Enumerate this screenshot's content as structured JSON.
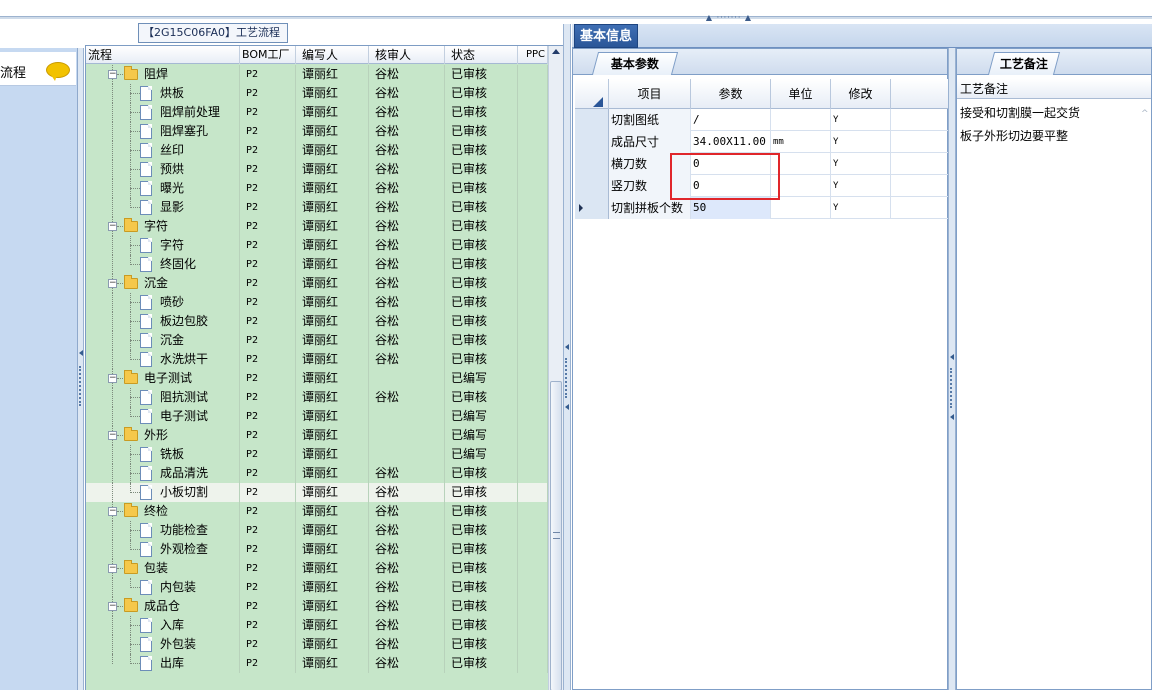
{
  "process_panel": {
    "title": "【2G15C06FA0】工艺流程",
    "headers": {
      "name": "流程",
      "bom": "BOM工厂",
      "writer": "编写人",
      "checker": "核审人",
      "status": "状态",
      "ppc": "PPC"
    }
  },
  "left_panel": {
    "item_label": "流程"
  },
  "tree_rows": [
    {
      "level": 0,
      "type": "folder",
      "name": "阻焊",
      "bom": "P2",
      "writer": "谭丽红",
      "checker": "谷松",
      "status": "已审核"
    },
    {
      "level": 1,
      "type": "doc",
      "name": "烘板",
      "bom": "P2",
      "writer": "谭丽红",
      "checker": "谷松",
      "status": "已审核"
    },
    {
      "level": 1,
      "type": "doc",
      "name": "阻焊前处理",
      "bom": "P2",
      "writer": "谭丽红",
      "checker": "谷松",
      "status": "已审核"
    },
    {
      "level": 1,
      "type": "doc",
      "name": "阻焊塞孔",
      "bom": "P2",
      "writer": "谭丽红",
      "checker": "谷松",
      "status": "已审核"
    },
    {
      "level": 1,
      "type": "doc",
      "name": "丝印",
      "bom": "P2",
      "writer": "谭丽红",
      "checker": "谷松",
      "status": "已审核"
    },
    {
      "level": 1,
      "type": "doc",
      "name": "预烘",
      "bom": "P2",
      "writer": "谭丽红",
      "checker": "谷松",
      "status": "已审核"
    },
    {
      "level": 1,
      "type": "doc",
      "name": "曝光",
      "bom": "P2",
      "writer": "谭丽红",
      "checker": "谷松",
      "status": "已审核"
    },
    {
      "level": 1,
      "type": "doc",
      "name": "显影",
      "bom": "P2",
      "writer": "谭丽红",
      "checker": "谷松",
      "status": "已审核",
      "last": true
    },
    {
      "level": 0,
      "type": "folder",
      "name": "字符",
      "bom": "P2",
      "writer": "谭丽红",
      "checker": "谷松",
      "status": "已审核"
    },
    {
      "level": 1,
      "type": "doc",
      "name": "字符",
      "bom": "P2",
      "writer": "谭丽红",
      "checker": "谷松",
      "status": "已审核"
    },
    {
      "level": 1,
      "type": "doc",
      "name": "终固化",
      "bom": "P2",
      "writer": "谭丽红",
      "checker": "谷松",
      "status": "已审核",
      "last": true
    },
    {
      "level": 0,
      "type": "folder",
      "name": "沉金",
      "bom": "P2",
      "writer": "谭丽红",
      "checker": "谷松",
      "status": "已审核"
    },
    {
      "level": 1,
      "type": "doc",
      "name": "喷砂",
      "bom": "P2",
      "writer": "谭丽红",
      "checker": "谷松",
      "status": "已审核"
    },
    {
      "level": 1,
      "type": "doc",
      "name": "板边包胶",
      "bom": "P2",
      "writer": "谭丽红",
      "checker": "谷松",
      "status": "已审核"
    },
    {
      "level": 1,
      "type": "doc",
      "name": "沉金",
      "bom": "P2",
      "writer": "谭丽红",
      "checker": "谷松",
      "status": "已审核"
    },
    {
      "level": 1,
      "type": "doc",
      "name": "水洗烘干",
      "bom": "P2",
      "writer": "谭丽红",
      "checker": "谷松",
      "status": "已审核",
      "last": true
    },
    {
      "level": 0,
      "type": "folder",
      "name": "电子测试",
      "bom": "P2",
      "writer": "谭丽红",
      "checker": "",
      "status": "已编写"
    },
    {
      "level": 1,
      "type": "doc",
      "name": "阻抗测试",
      "bom": "P2",
      "writer": "谭丽红",
      "checker": "谷松",
      "status": "已审核"
    },
    {
      "level": 1,
      "type": "doc",
      "name": "电子测试",
      "bom": "P2",
      "writer": "谭丽红",
      "checker": "",
      "status": "已编写",
      "last": true
    },
    {
      "level": 0,
      "type": "folder",
      "name": "外形",
      "bom": "P2",
      "writer": "谭丽红",
      "checker": "",
      "status": "已编写"
    },
    {
      "level": 1,
      "type": "doc",
      "name": "铣板",
      "bom": "P2",
      "writer": "谭丽红",
      "checker": "",
      "status": "已编写"
    },
    {
      "level": 1,
      "type": "doc",
      "name": "成品清洗",
      "bom": "P2",
      "writer": "谭丽红",
      "checker": "谷松",
      "status": "已审核"
    },
    {
      "level": 1,
      "type": "doc",
      "name": "小板切割",
      "bom": "P2",
      "writer": "谭丽红",
      "checker": "谷松",
      "status": "已审核",
      "last": true,
      "selected": true
    },
    {
      "level": 0,
      "type": "folder",
      "name": "终检",
      "bom": "P2",
      "writer": "谭丽红",
      "checker": "谷松",
      "status": "已审核"
    },
    {
      "level": 1,
      "type": "doc",
      "name": "功能检查",
      "bom": "P2",
      "writer": "谭丽红",
      "checker": "谷松",
      "status": "已审核"
    },
    {
      "level": 1,
      "type": "doc",
      "name": "外观检查",
      "bom": "P2",
      "writer": "谭丽红",
      "checker": "谷松",
      "status": "已审核",
      "last": true
    },
    {
      "level": 0,
      "type": "folder",
      "name": "包装",
      "bom": "P2",
      "writer": "谭丽红",
      "checker": "谷松",
      "status": "已审核"
    },
    {
      "level": 1,
      "type": "doc",
      "name": "内包装",
      "bom": "P2",
      "writer": "谭丽红",
      "checker": "谷松",
      "status": "已审核",
      "last": true
    },
    {
      "level": 0,
      "type": "folder",
      "name": "成品仓",
      "bom": "P2",
      "writer": "谭丽红",
      "checker": "谷松",
      "status": "已审核"
    },
    {
      "level": 1,
      "type": "doc",
      "name": "入库",
      "bom": "P2",
      "writer": "谭丽红",
      "checker": "谷松",
      "status": "已审核"
    },
    {
      "level": 1,
      "type": "doc",
      "name": "外包装",
      "bom": "P2",
      "writer": "谭丽红",
      "checker": "谷松",
      "status": "已审核"
    },
    {
      "level": 1,
      "type": "doc",
      "name": "出库",
      "bom": "P2",
      "writer": "谭丽红",
      "checker": "谷松",
      "status": "已审核",
      "last": true
    }
  ],
  "info_panel": {
    "tab_label": "基本信息",
    "sub_tab_label": "基本参数",
    "headers": {
      "item": "项目",
      "param": "参数",
      "unit": "单位",
      "modify": "修改"
    },
    "rows": [
      {
        "item": "切割图纸",
        "param": "/",
        "unit": "",
        "modify": "Y"
      },
      {
        "item": "成品尺寸",
        "param": "34.00X11.00",
        "unit": "mm",
        "modify": "Y"
      },
      {
        "item": "横刀数",
        "param": "0",
        "unit": "",
        "modify": "Y"
      },
      {
        "item": "竖刀数",
        "param": "0",
        "unit": "",
        "modify": "Y"
      },
      {
        "item": "切割拼板个数",
        "param": "50",
        "unit": "",
        "modify": "Y",
        "current": true
      }
    ]
  },
  "notes_panel": {
    "tab_label": "工艺备注",
    "header": "工艺备注",
    "lines": [
      "接受和切割膜一起交货",
      "板子外形切边要平整"
    ]
  }
}
